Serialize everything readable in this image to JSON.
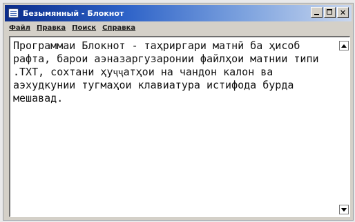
{
  "window": {
    "title": "Безымянный - Блокнот",
    "buttons": {
      "minimize_icon": "minimize-icon",
      "maximize_icon": "maximize-icon",
      "close_icon": "close-icon",
      "close_label": "✕"
    }
  },
  "menu": {
    "items": [
      {
        "label": "Файл"
      },
      {
        "label": "Правка"
      },
      {
        "label": "Поиск"
      },
      {
        "label": "Справка"
      }
    ]
  },
  "document": {
    "text": "Программаи Блокнот - таҳриргари матнӣ ба ҳисоб рафта, барои аэназаргузаронии файлҳои матнии типи .TXT, сохтани ҳуҷҷатҳои на чандон калон ва аэхудкунии тугмаҳои клавиатура истифода бурда мешавад."
  },
  "scrollbar": {
    "up_icon": "scroll-up-arrow-icon",
    "down_icon": "scroll-down-arrow-icon"
  },
  "colors": {
    "titlebar_start": "#0b2c8a",
    "titlebar_end": "#c9d7ef",
    "window_face": "#d4d0c8",
    "edit_background": "#ffffff"
  }
}
